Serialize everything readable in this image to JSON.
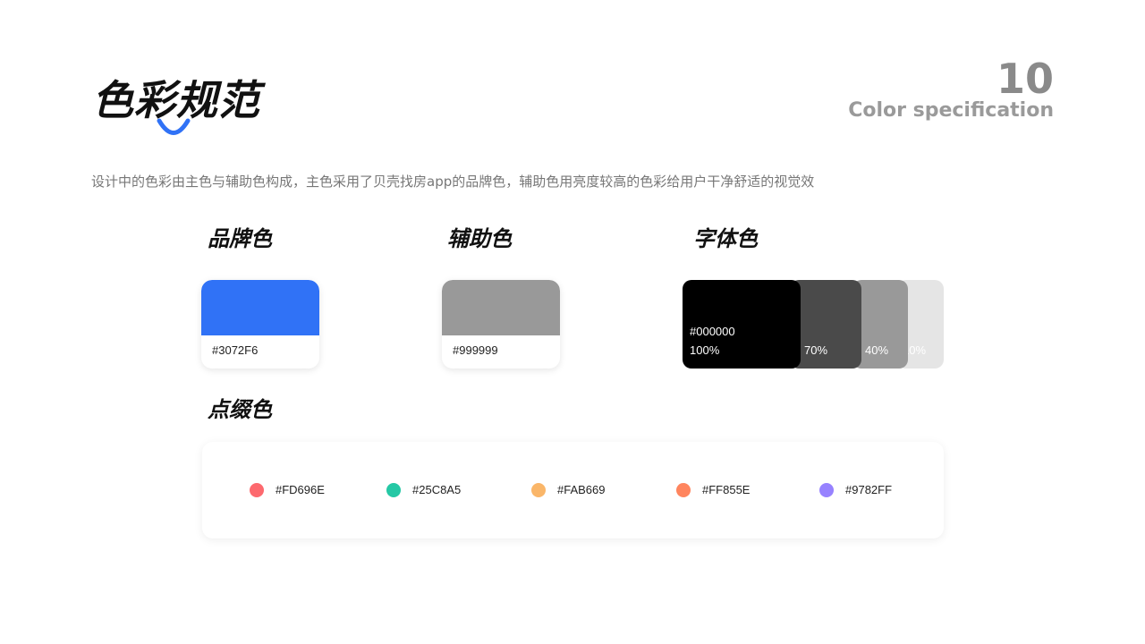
{
  "header": {
    "title": "色彩规范",
    "page_number": "10",
    "subtitle": "Color specification",
    "accent_color": "#3072F6"
  },
  "description": "设计中的色彩由主色与辅助色构成，主色采用了贝壳找房app的品牌色，辅助色用亮度较高的色彩给用户干净舒适的视觉效",
  "brand": {
    "heading": "品牌色",
    "color": "#3072F6",
    "hex": "#3072F6"
  },
  "secondary": {
    "heading": "辅助色",
    "color": "#999999",
    "hex": "#999999"
  },
  "font_colors": {
    "heading": "字体色",
    "hex": "#000000",
    "levels": [
      {
        "label": "100%",
        "color": "#000000",
        "opacity": 1.0
      },
      {
        "label": "70%",
        "color": "#4A4A4A",
        "opacity": 0.7
      },
      {
        "label": "40%",
        "color": "#999999",
        "opacity": 0.4
      },
      {
        "label": "10%",
        "color": "#E5E5E5",
        "opacity": 0.1
      }
    ]
  },
  "accent": {
    "heading": "点缀色",
    "items": [
      {
        "hex": "#FD696E",
        "color": "#FD696E"
      },
      {
        "hex": "#25C8A5",
        "color": "#25C8A5"
      },
      {
        "hex": "#FAB669",
        "color": "#FAB669"
      },
      {
        "hex": "#FF855E",
        "color": "#FF855E"
      },
      {
        "hex": "#9782FF",
        "color": "#9782FF"
      }
    ]
  }
}
